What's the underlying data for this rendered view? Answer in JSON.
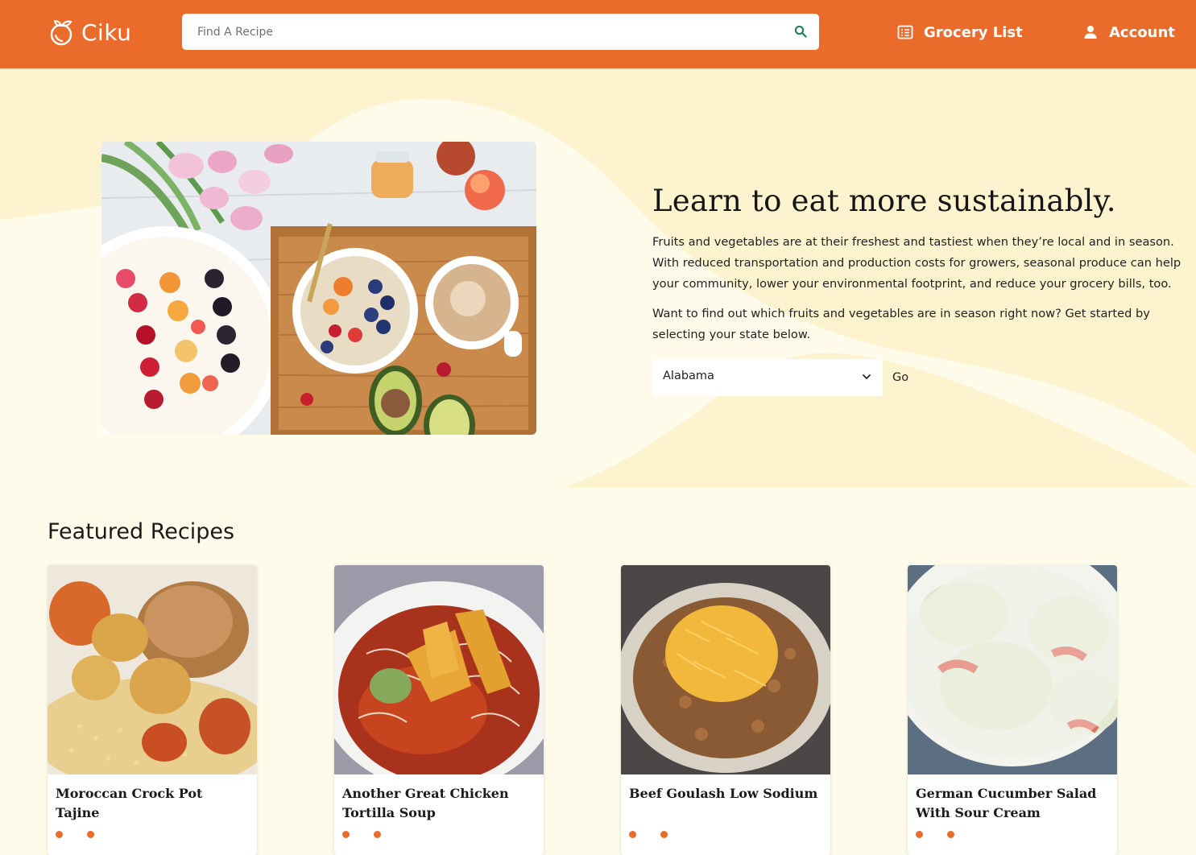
{
  "app": {
    "brand": "Ciku"
  },
  "header": {
    "search_placeholder": "Find A Recipe",
    "search_value": "",
    "grocery_label": "Grocery List",
    "account_label": "Account"
  },
  "hero": {
    "title": "Learn to eat more sustainably.",
    "paragraph1": "Fruits and vegetables are at their freshest and tastiest when they’re local and in season. With reduced transportation and production costs for growers, seasonal produce can help your community, lower your environmental footprint, and reduce your grocery bills, too.",
    "paragraph2": "Want to find out which fruits and vegetables are in season right now? Get started by selecting your state below.",
    "state_selected": "Alabama",
    "go_label": "Go"
  },
  "featured": {
    "heading": "Featured Recipes",
    "recipes": [
      {
        "title": "Moroccan Crock Pot Tajine"
      },
      {
        "title": "Another Great Chicken Tortilla Soup"
      },
      {
        "title": "Beef Goulash Low Sodium"
      },
      {
        "title": "German Cucumber Salad With Sour Cream"
      }
    ]
  },
  "colors": {
    "brand_orange": "#ea6b2a",
    "page_background": "#fefbea",
    "hero_wave": "#fdf3cf"
  },
  "icons": {
    "logo": "orange-fruit-icon",
    "search": "search-icon",
    "grocery": "list-icon",
    "account": "user-icon",
    "select": "chevron-down-icon"
  }
}
